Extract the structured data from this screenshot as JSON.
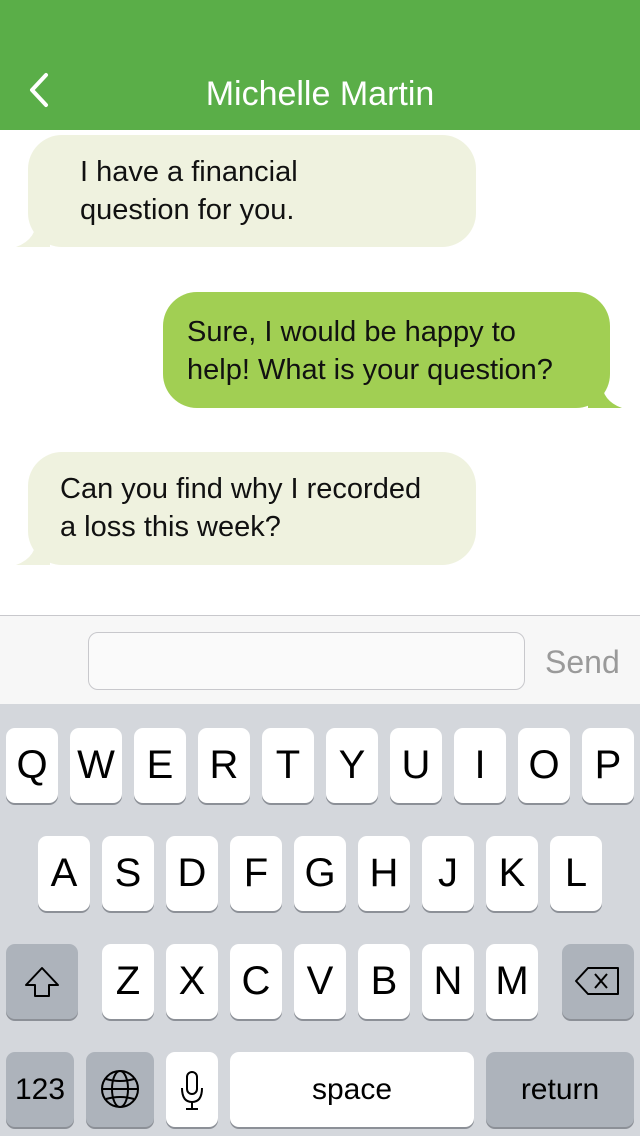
{
  "header": {
    "title": "Michelle Martin",
    "back_icon": "chevron-left-icon",
    "color": "#5aae48"
  },
  "messages": [
    {
      "direction": "incoming",
      "lines": [
        "I have a financial",
        "question for you."
      ]
    },
    {
      "direction": "outgoing",
      "lines": [
        "Sure, I would be happy to",
        "help!  What is your question?"
      ]
    },
    {
      "direction": "incoming",
      "lines": [
        "Can you find why I recorded",
        "a loss this week?"
      ]
    }
  ],
  "composer": {
    "value": "",
    "placeholder": "",
    "send_label": "Send"
  },
  "keyboard": {
    "row1": [
      "Q",
      "W",
      "E",
      "R",
      "T",
      "Y",
      "U",
      "I",
      "O",
      "P"
    ],
    "row2": [
      "A",
      "S",
      "D",
      "F",
      "G",
      "H",
      "J",
      "K",
      "L"
    ],
    "row3": [
      "Z",
      "X",
      "C",
      "V",
      "B",
      "N",
      "M"
    ],
    "shift_icon": "shift-icon",
    "backspace_icon": "backspace-icon",
    "numbers_label": "123",
    "globe_icon": "globe-icon",
    "mic_icon": "microphone-icon",
    "space_label": "space",
    "return_label": "return"
  },
  "colors": {
    "incoming_bubble": "#eff2df",
    "outgoing_bubble": "#a1cf53",
    "keyboard_bg": "#d4d7dc"
  }
}
